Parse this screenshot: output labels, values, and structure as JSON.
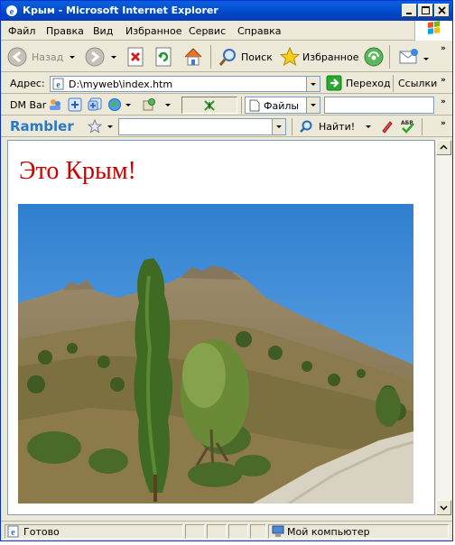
{
  "window": {
    "title": "Крым - Microsoft Internet Explorer",
    "accent_color": "#0453d4"
  },
  "menubar": {
    "items": [
      {
        "label": "Файл"
      },
      {
        "label": "Правка"
      },
      {
        "label": "Вид"
      },
      {
        "label": "Избранное"
      },
      {
        "label": "Сервис"
      },
      {
        "label": "Справка"
      }
    ]
  },
  "toolbar": {
    "back_label": "Назад",
    "search_label": "Поиск",
    "favorites_label": "Избранное",
    "icons": [
      "back-arrow-icon",
      "forward-arrow-icon",
      "stop-icon",
      "refresh-icon",
      "home-icon",
      "search-magnifier-icon",
      "favorites-star-icon",
      "media-icon",
      "mail-icon"
    ]
  },
  "address_bar": {
    "label": "Адрес:",
    "url": "D:\\myweb\\index.htm",
    "go_label": "Переход",
    "links_label": "Ссылки"
  },
  "dm_bar": {
    "label": "DM Bar",
    "files_label": "Файлы"
  },
  "rambler_bar": {
    "logo": "Rambler",
    "search_value": "",
    "find_label": "Найти!"
  },
  "page": {
    "heading": "Это Крым!",
    "heading_color": "#d00000",
    "image": "crimea-mountain-landscape"
  },
  "status_bar": {
    "status_text": "Готово",
    "zone_text": "Мой компьютер"
  }
}
